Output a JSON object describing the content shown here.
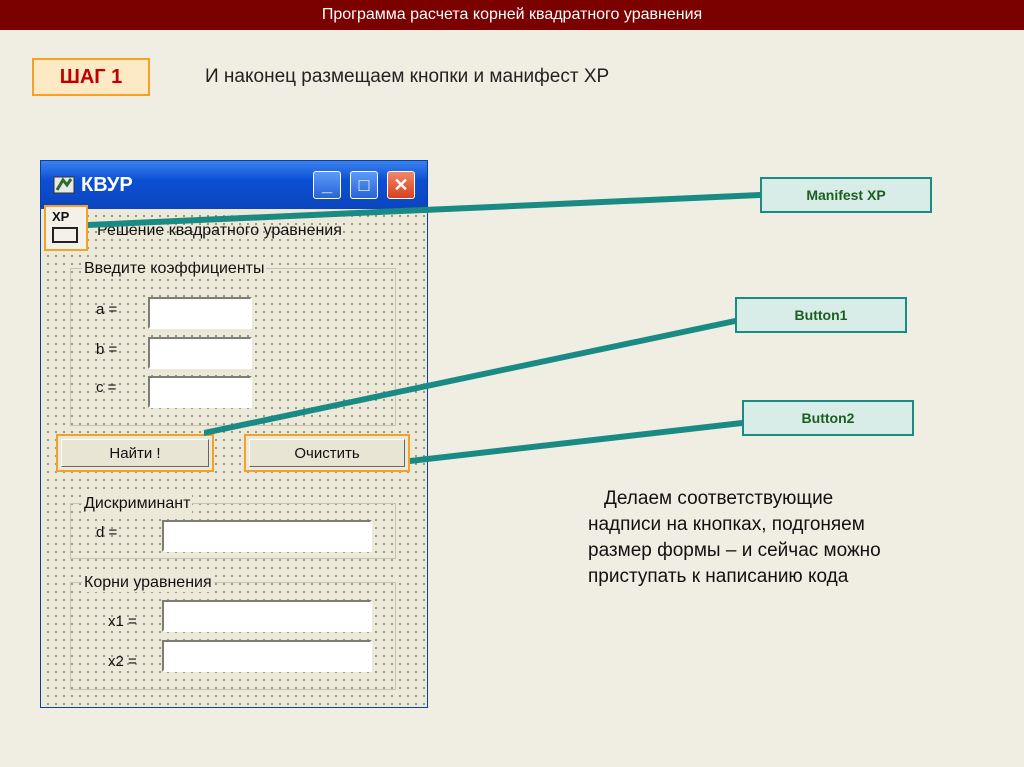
{
  "header": {
    "title": "Программа расчета корней квадратного уравнения"
  },
  "step": {
    "label": "ШАГ 1"
  },
  "headline": "И наконец размещаем кнопки и манифест XP",
  "form": {
    "title": "КВУР",
    "window_buttons": {
      "minimize": "_",
      "maximize": "□",
      "close": "✕"
    },
    "xp_icon_label": "XP",
    "main_label": "Решение квадратного уравнения",
    "group_coeffs": {
      "label": "Введите коэффициенты",
      "fields": [
        {
          "label": "a =",
          "value": ""
        },
        {
          "label": "b =",
          "value": ""
        },
        {
          "label": "c =",
          "value": ""
        }
      ]
    },
    "buttons": {
      "find": "Найти !",
      "clear": "Очистить"
    },
    "group_discriminant": {
      "label": "Дискриминант",
      "field_label": "d =",
      "value": ""
    },
    "group_roots": {
      "label": "Корни уравнения",
      "fields": [
        {
          "label": "x1 =",
          "value": ""
        },
        {
          "label": "x2 =",
          "value": ""
        }
      ]
    }
  },
  "callouts": {
    "manifest": "Manifest XP",
    "button1": "Button1",
    "button2": "Button2"
  },
  "description": "Делаем соответствующие надписи на кнопках, подгоняем размер формы – и сейчас можно приступать к написанию кода",
  "colors": {
    "header_bg": "#7b0000",
    "accent_orange": "#f4a12a",
    "callout_border": "#1a8a84",
    "step_text": "#c00000"
  }
}
